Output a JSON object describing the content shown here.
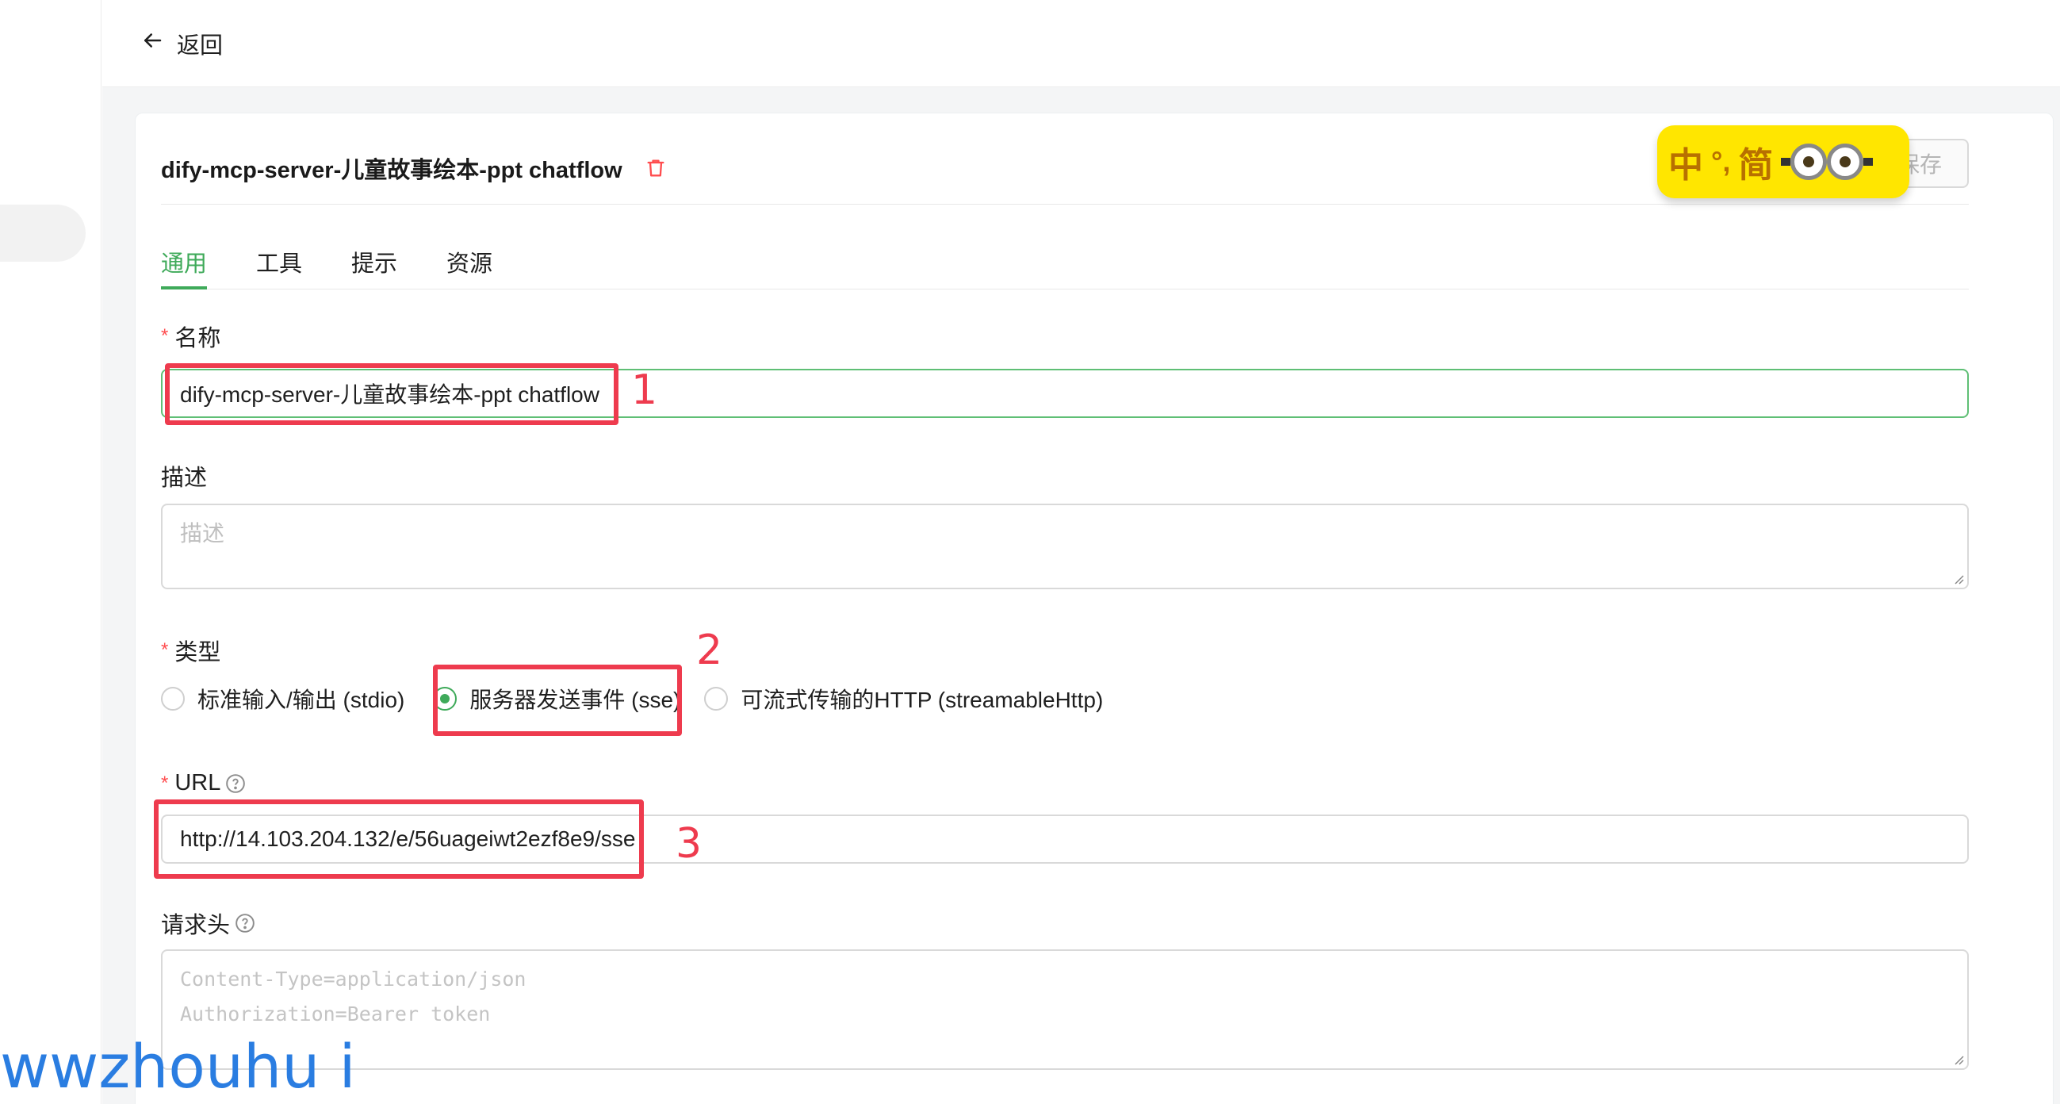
{
  "header": {
    "back_label": "返回"
  },
  "card": {
    "title": "dify-mcp-server-儿童故事绘本-ppt chatflow",
    "save_label": "保存"
  },
  "ime": {
    "char1": "中",
    "punct": "°,",
    "char2": "简"
  },
  "tabs": [
    {
      "label": "通用",
      "active": true
    },
    {
      "label": "工具",
      "active": false
    },
    {
      "label": "提示",
      "active": false
    },
    {
      "label": "资源",
      "active": false
    }
  ],
  "form": {
    "name": {
      "label": "名称",
      "required": true,
      "value": "dify-mcp-server-儿童故事绘本-ppt chatflow"
    },
    "description": {
      "label": "描述",
      "placeholder": "描述"
    },
    "type": {
      "label": "类型",
      "required": true,
      "options": [
        {
          "label": "标准输入/输出 (stdio)",
          "checked": false
        },
        {
          "label": "服务器发送事件 (sse)",
          "checked": true
        },
        {
          "label": "可流式传输的HTTP (streamableHttp)",
          "checked": false
        }
      ]
    },
    "url": {
      "label": "URL",
      "required": true,
      "value": "http://14.103.204.132/e/56uageiwt2ezf8e9/sse"
    },
    "headers": {
      "label": "请求头",
      "placeholder_line1": "Content-Type=application/json",
      "placeholder_line2": "Authorization=Bearer token"
    }
  },
  "annotations": [
    "1",
    "2",
    "3"
  ],
  "watermark": "wwzhouhu i",
  "colors": {
    "accent": "#3faa5a",
    "annotation": "#ee3b4e",
    "required": "#ff4d4f",
    "ime_bg": "#ffe600",
    "watermark": "#2a7de1"
  }
}
